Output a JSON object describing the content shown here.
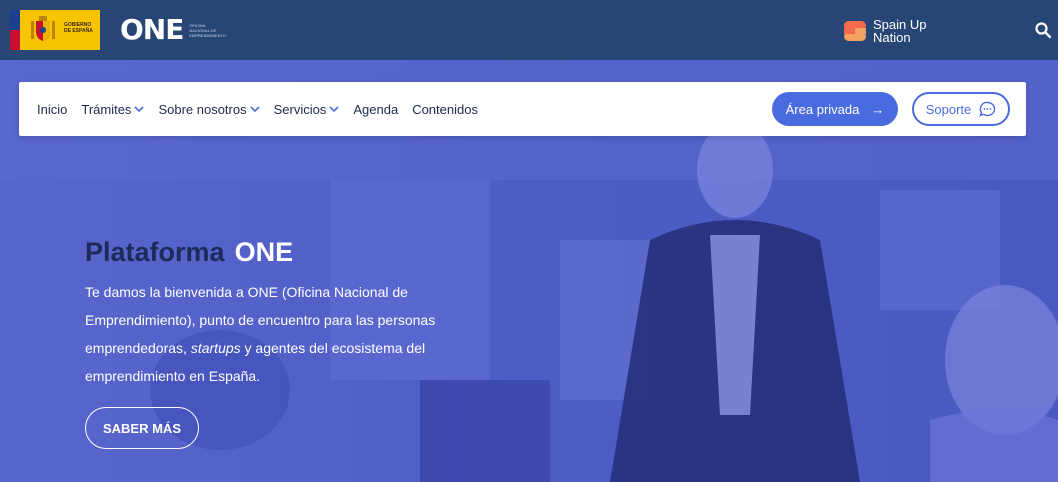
{
  "header": {
    "gov_logo": {
      "line1": "GOBIERNO",
      "line2": "DE ESPAÑA",
      "icon": "spain-coat-of-arms"
    },
    "one_logo": {
      "mark": "ONE",
      "sub_line1": "OFICINA",
      "sub_line2": "NACIONAL DE",
      "sub_line3": "EMPRENDIMIENTO"
    },
    "spain_up": {
      "line1": "Spain Up",
      "line2": "Nation",
      "icon": "spain-up-s-icon"
    },
    "search_icon": "search-icon"
  },
  "nav": {
    "items": [
      {
        "label": "Inicio",
        "dropdown": false
      },
      {
        "label": "Trámites",
        "dropdown": true
      },
      {
        "label": "Sobre nosotros",
        "dropdown": true
      },
      {
        "label": "Servicios",
        "dropdown": true
      },
      {
        "label": "Agenda",
        "dropdown": false
      },
      {
        "label": "Contenidos",
        "dropdown": false
      }
    ],
    "area_privada": {
      "label": "Área privada",
      "arrow": "→"
    },
    "soporte": {
      "label": "Soporte",
      "icon": "chat-bubble-icon"
    }
  },
  "hero": {
    "title_part1": "Plataforma",
    "title_part2": "ONE",
    "desc_before": "Te damos la bienvenida a ONE (Oficina Nacional de Emprendimiento), punto de encuentro para las personas emprendedoras, ",
    "desc_em": "startups",
    "desc_after": " y agentes del ecosistema del emprendimiento en España.",
    "cta_label": "SABER MÁS"
  },
  "colors": {
    "header_bg": "#274575",
    "gov_yellow": "#f6c400",
    "primary_button": "#4a6be0",
    "hero_overlay": "#4a59c4",
    "title_dark": "#1d2a5a"
  }
}
